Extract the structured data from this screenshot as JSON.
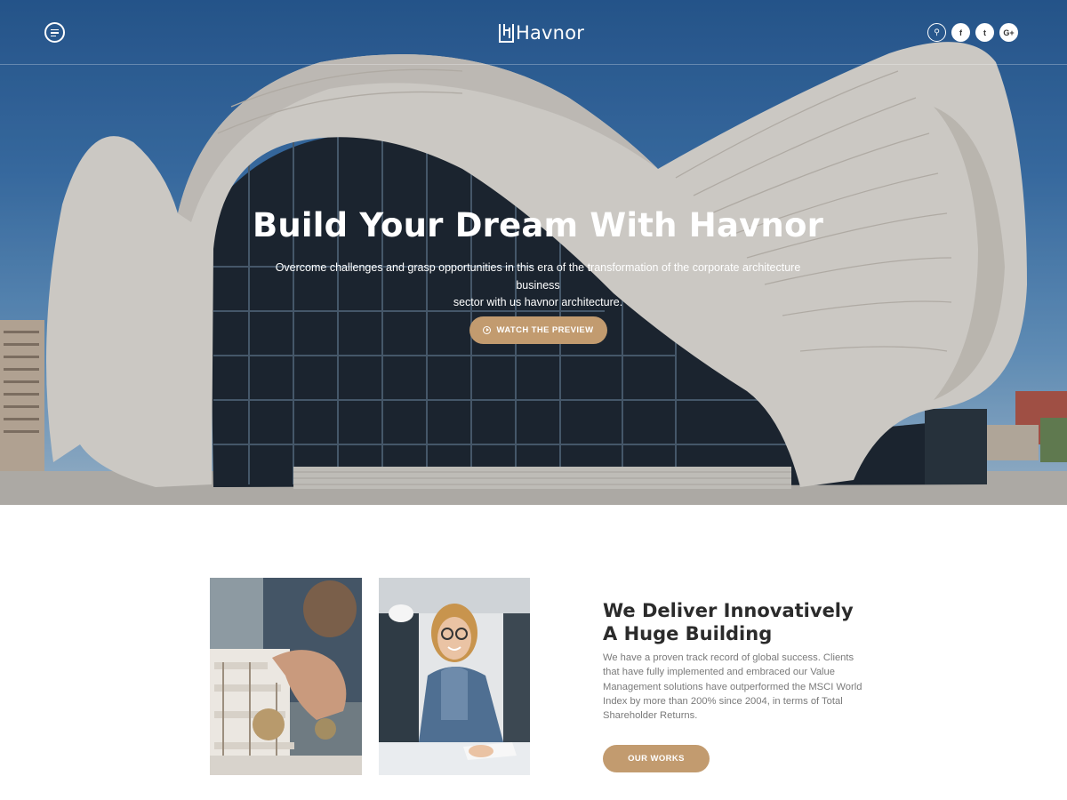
{
  "header": {
    "brand": "Havnor",
    "menu_icon": "hamburger-menu-icon",
    "social": [
      {
        "icon": "search-icon",
        "glyph": "⚲"
      },
      {
        "icon": "facebook-icon",
        "glyph": "f"
      },
      {
        "icon": "twitter-icon",
        "glyph": "t"
      },
      {
        "icon": "google-plus-icon",
        "glyph": "G+"
      }
    ]
  },
  "hero": {
    "title": "Build Your Dream With Havnor",
    "subtitle_line1": "Overcome challenges and grasp opportunities in this era of the transformation of the corporate architecture business",
    "subtitle_line2": "sector with us havnor architecture.",
    "button_label": "WATCH THE PREVIEW",
    "button_icon": "play-circle-icon"
  },
  "about": {
    "title_line1": "We Deliver Innovatively",
    "title_line2": "A Huge Building",
    "text": "We have a proven track record of global success. Clients that have fully implemented and embraced our Value Management solutions have outperformed the MSCI World Index by more than 200% since 2004, in terms of Total Shareholder Returns.",
    "button_label": "OUR WORKS"
  },
  "colors": {
    "accent": "#c29b6f",
    "sky": "#3f78b4",
    "text_dark": "#2b2b2b",
    "text_muted": "#7a7a7a"
  }
}
